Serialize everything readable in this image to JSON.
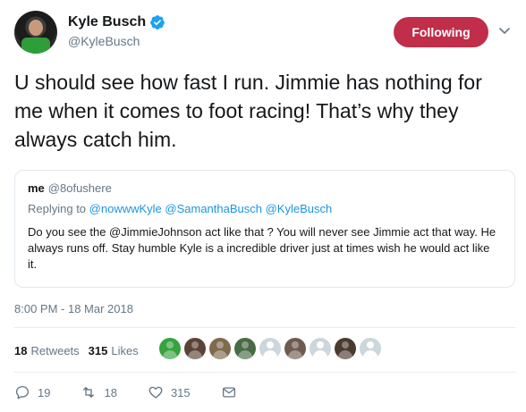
{
  "header": {
    "name": "Kyle Busch",
    "handle": "@KyleBusch",
    "follow_label": "Following",
    "follow_color": "#c02e49"
  },
  "tweet": {
    "text": "U should see how fast I run. Jimmie has nothing for me when it comes to foot racing! That’s why they always catch him.",
    "timestamp": "8:00 PM - 18 Mar 2018"
  },
  "quote": {
    "name": "me",
    "handle": "@8ofushere",
    "replying_prefix": "Replying to",
    "replying_to": "@nowwwKyle @SamanthaBusch @KyleBusch",
    "body": "Do you see the @JimmieJohnson act like that ? You will never see Jimmie act that way. He always runs off. Stay humble Kyle is a incredible driver just at times wish he would act like it."
  },
  "stats": {
    "retweets_count": "18",
    "retweets_label": "Retweets",
    "likes_count": "315",
    "likes_label": "Likes"
  },
  "actions": {
    "reply_count": "19",
    "retweet_count": "18",
    "like_count": "315"
  },
  "colors": {
    "accent": "#1b95e0",
    "muted": "#657786",
    "text": "#14171a"
  }
}
